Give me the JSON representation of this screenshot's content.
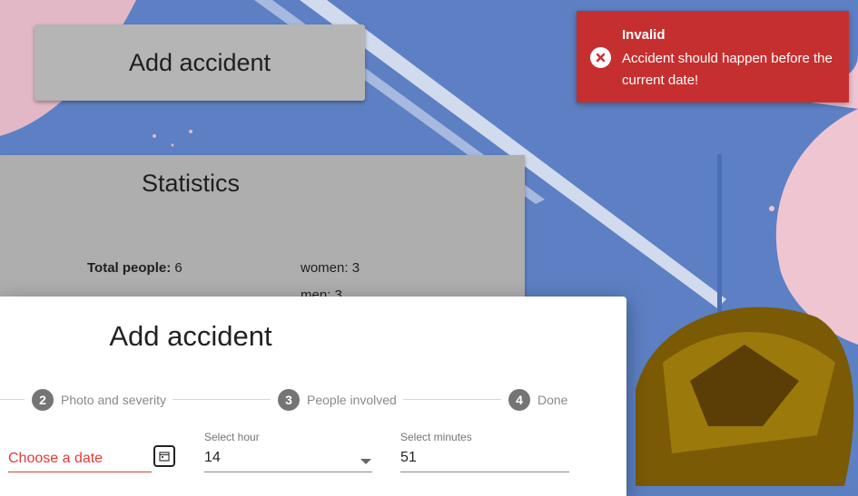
{
  "header": {
    "add_button_label": "Add accident"
  },
  "statistics": {
    "title": "Statistics",
    "total_label": "Total people:",
    "total_value": "6",
    "women": "women: 3",
    "men": "men: 3"
  },
  "dialog": {
    "title": "Add accident",
    "steps": [
      {
        "num": "2",
        "label": "Photo and severity"
      },
      {
        "num": "3",
        "label": "People involved"
      },
      {
        "num": "4",
        "label": "Done"
      }
    ],
    "date": {
      "placeholder": "Choose a date"
    },
    "hour": {
      "label": "Select hour",
      "value": "14"
    },
    "minutes": {
      "label": "Select minutes",
      "value": "51"
    }
  },
  "toast": {
    "title": "Invalid",
    "message": "Accident should happen before the current date!",
    "color": "#c62f2f"
  },
  "icons": {
    "calendar": "calendar-icon",
    "error": "error-icon",
    "dropdown": "chevron-down-icon"
  }
}
